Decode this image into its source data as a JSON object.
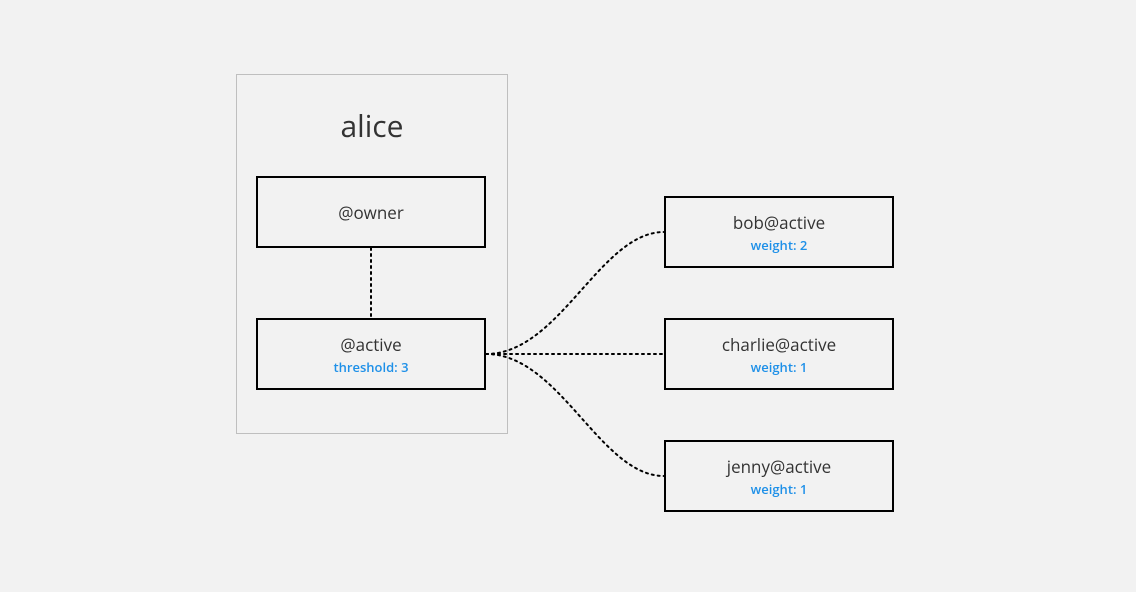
{
  "account": {
    "name": "alice",
    "permissions": {
      "owner": {
        "label": "@owner"
      },
      "active": {
        "label": "@active",
        "threshold_label": "threshold: 3"
      }
    }
  },
  "delegates": {
    "bob": {
      "label": "bob@active",
      "weight_label": "weight: 2"
    },
    "charlie": {
      "label": "charlie@active",
      "weight_label": "weight: 1"
    },
    "jenny": {
      "label": "jenny@active",
      "weight_label": "weight: 1"
    }
  }
}
